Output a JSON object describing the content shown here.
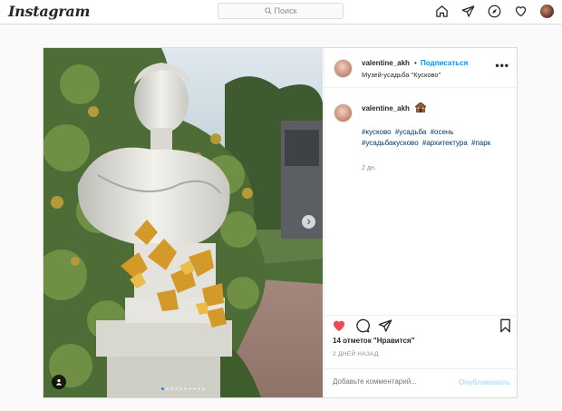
{
  "app": {
    "logo": "Instagram"
  },
  "search": {
    "placeholder": "Поиск"
  },
  "nav": {
    "icons": [
      "home-icon",
      "direct-icon",
      "explore-icon",
      "activity-icon",
      "profile-avatar"
    ]
  },
  "post": {
    "username": "valentine_akh",
    "separator": "•",
    "follow_label": "Подписаться",
    "location": "Музей-усадьба \"Кусково\"",
    "more_label": "•••",
    "caption": {
      "username": "valentine_akh",
      "hashtags": [
        "#кусково",
        "#усадьба",
        "#осень",
        "#усадьбакусково",
        "#архитектура",
        "#парк"
      ],
      "time": "2 дн."
    },
    "likes": "14 отметок \"Нравится\"",
    "timestamp": "2 ДНЕЙ НАЗАД",
    "comment_placeholder": "Добавьте комментарий...",
    "publish_label": "Опубликовать",
    "carousel": {
      "slide_count": 10,
      "active_index": 0
    },
    "liked": true
  },
  "colors": {
    "accent": "#0095f6",
    "like": "#ed4956",
    "hashtag": "#00376b",
    "muted": "#8e8e8e"
  }
}
